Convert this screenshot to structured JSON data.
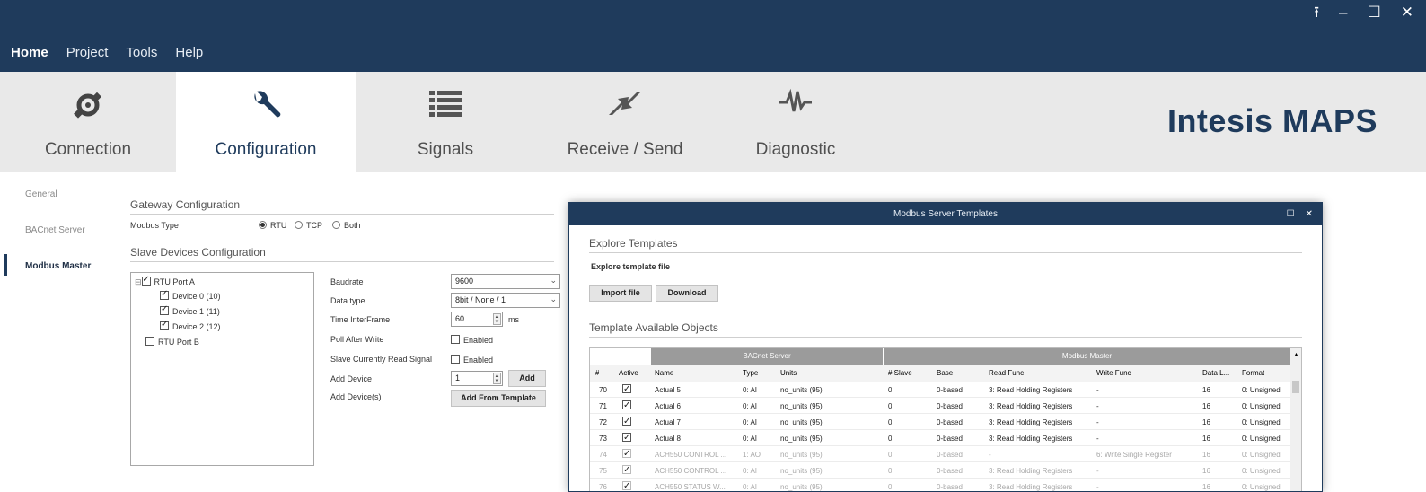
{
  "window_controls": [
    "⭱",
    "–",
    "☐",
    "✕"
  ],
  "menu": {
    "home": "Home",
    "project": "Project",
    "tools": "Tools",
    "help": "Help"
  },
  "tabs": [
    {
      "label": "Connection",
      "icon": "connection-plug-icon"
    },
    {
      "label": "Configuration",
      "icon": "wrench-icon"
    },
    {
      "label": "Signals",
      "icon": "list-icon"
    },
    {
      "label": "Receive / Send",
      "icon": "transfer-arrows-icon"
    },
    {
      "label": "Diagnostic",
      "icon": "pulse-icon"
    }
  ],
  "brand": "Intesis MAPS",
  "sidebar": {
    "general": "General",
    "bacnet_server": "BACnet Server",
    "modbus_master": "Modbus Master"
  },
  "gateway": {
    "title": "Gateway Configuration",
    "modbus_type_label": "Modbus Type",
    "options": [
      "RTU",
      "TCP",
      "Both"
    ],
    "selected": "RTU"
  },
  "slave": {
    "title": "Slave Devices Configuration",
    "tree": {
      "port_a": "RTU Port A",
      "devices": [
        "Device 0 (10)",
        "Device 1 (11)",
        "Device 2 (12)"
      ],
      "port_b": "RTU Port B"
    },
    "labels": {
      "baudrate": "Baudrate",
      "data_type": "Data type",
      "time_interframe": "Time InterFrame",
      "poll_after_write": "Poll After Write",
      "slave_currently": "Slave Currently Read Signal",
      "add_device": "Add Device",
      "add_devices": "Add Device(s)"
    },
    "values": {
      "baudrate": "9600",
      "data_type": "8bit / None / 1",
      "time_interframe": "60",
      "ms": "ms",
      "enabled1": "Enabled",
      "enabled2": "Enabled",
      "add_count": "1",
      "add_btn": "Add",
      "add_from_template": "Add From Template"
    }
  },
  "modal": {
    "title": "Modbus Server Templates",
    "controls": [
      "☐",
      "✕"
    ],
    "explore_title": "Explore Templates",
    "explore_file": "Explore template file",
    "import_btn": "Import file",
    "download_btn": "Download",
    "objects_title": "Template Available Objects",
    "groups": {
      "bacnet": "BACnet Server",
      "modbus": "Modbus Master"
    },
    "headers": [
      "#",
      "Active",
      "Name",
      "Type",
      "Units",
      "# Slave",
      "Base",
      "Read Func",
      "Write Func",
      "Data L...",
      "Format"
    ],
    "rows": [
      {
        "num": "70",
        "name": "Actual 5",
        "type": "0: AI",
        "units": "no_units (95)",
        "slave": "0",
        "base": "0-based",
        "read": "3: Read Holding Registers",
        "write": "-",
        "len": "16",
        "format": "0: Unsigned",
        "active": true
      },
      {
        "num": "71",
        "name": "Actual 6",
        "type": "0: AI",
        "units": "no_units (95)",
        "slave": "0",
        "base": "0-based",
        "read": "3: Read Holding Registers",
        "write": "-",
        "len": "16",
        "format": "0: Unsigned",
        "active": true
      },
      {
        "num": "72",
        "name": "Actual 7",
        "type": "0: AI",
        "units": "no_units (95)",
        "slave": "0",
        "base": "0-based",
        "read": "3: Read Holding Registers",
        "write": "-",
        "len": "16",
        "format": "0: Unsigned",
        "active": true
      },
      {
        "num": "73",
        "name": "Actual 8",
        "type": "0: AI",
        "units": "no_units (95)",
        "slave": "0",
        "base": "0-based",
        "read": "3: Read Holding Registers",
        "write": "-",
        "len": "16",
        "format": "0: Unsigned",
        "active": true
      },
      {
        "num": "74",
        "name": "ACH550 CONTROL ...",
        "type": "1: AO",
        "units": "no_units (95)",
        "slave": "0",
        "base": "0-based",
        "read": "-",
        "write": "6: Write Single Register",
        "len": "16",
        "format": "0: Unsigned",
        "active": false
      },
      {
        "num": "75",
        "name": "ACH550 CONTROL ...",
        "type": "0: AI",
        "units": "no_units (95)",
        "slave": "0",
        "base": "0-based",
        "read": "3: Read Holding Registers",
        "write": "-",
        "len": "16",
        "format": "0: Unsigned",
        "active": false
      },
      {
        "num": "76",
        "name": "ACH550 STATUS W...",
        "type": "0: AI",
        "units": "no_units (95)",
        "slave": "0",
        "base": "0-based",
        "read": "3: Read Holding Registers",
        "write": "-",
        "len": "16",
        "format": "0: Unsigned",
        "active": false
      }
    ]
  },
  "colors": {
    "primary": "#1f3b5c",
    "ribbon": "#e9e9e9"
  }
}
